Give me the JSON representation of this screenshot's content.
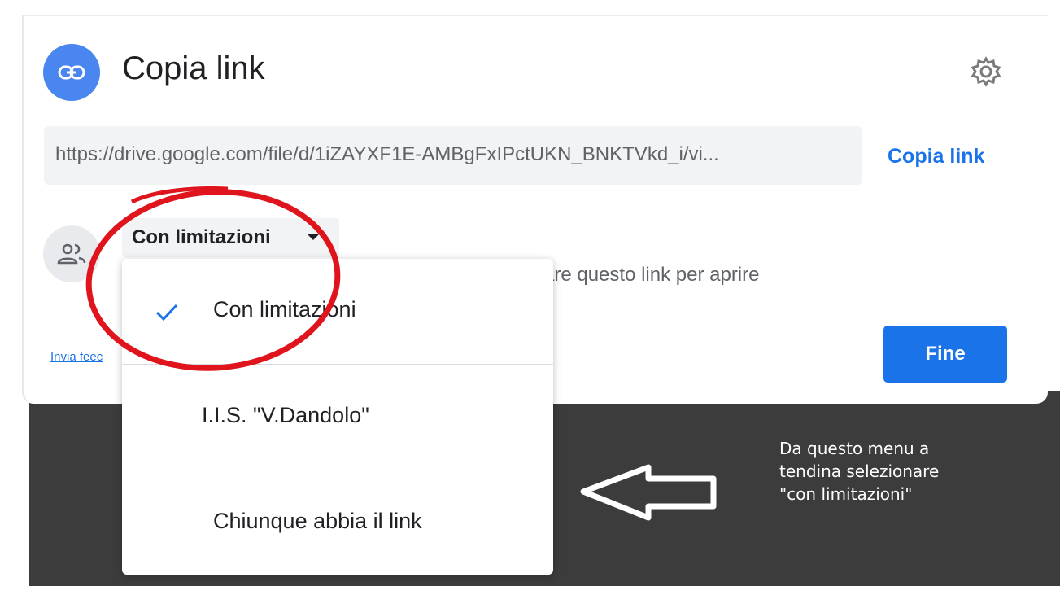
{
  "dialog": {
    "title": "Copia link",
    "url": "https://drive.google.com/file/d/1iZAYXF1E-AMBgFxIPctUKN_BNKTVkd_i/vi...",
    "copy_link_label": "Copia link",
    "access_level": "Con limitazioni",
    "description_fragment": "are questo link per aprire",
    "feedback_link": "Invia feec",
    "done_label": "Fine"
  },
  "menu": {
    "items": [
      {
        "label": "Con limitazioni",
        "selected": true
      },
      {
        "label": "I.I.S. \"V.Dandolo\"",
        "selected": false
      },
      {
        "label": "Chiunque abbia il link",
        "selected": false
      }
    ]
  },
  "annotation": {
    "line1": "Da questo menu a",
    "line2": "tendina selezionare",
    "line3": "\"con limitazioni\""
  },
  "colors": {
    "accent": "#1a73e8",
    "link_badge": "#4a86f0",
    "highlight_circle": "#e0141c",
    "overlay": "#3c3c3c"
  },
  "icons": {
    "badge": "link-icon",
    "settings": "gear-icon",
    "people": "people-icon",
    "selected": "check-icon",
    "callout": "left-arrow-icon"
  }
}
